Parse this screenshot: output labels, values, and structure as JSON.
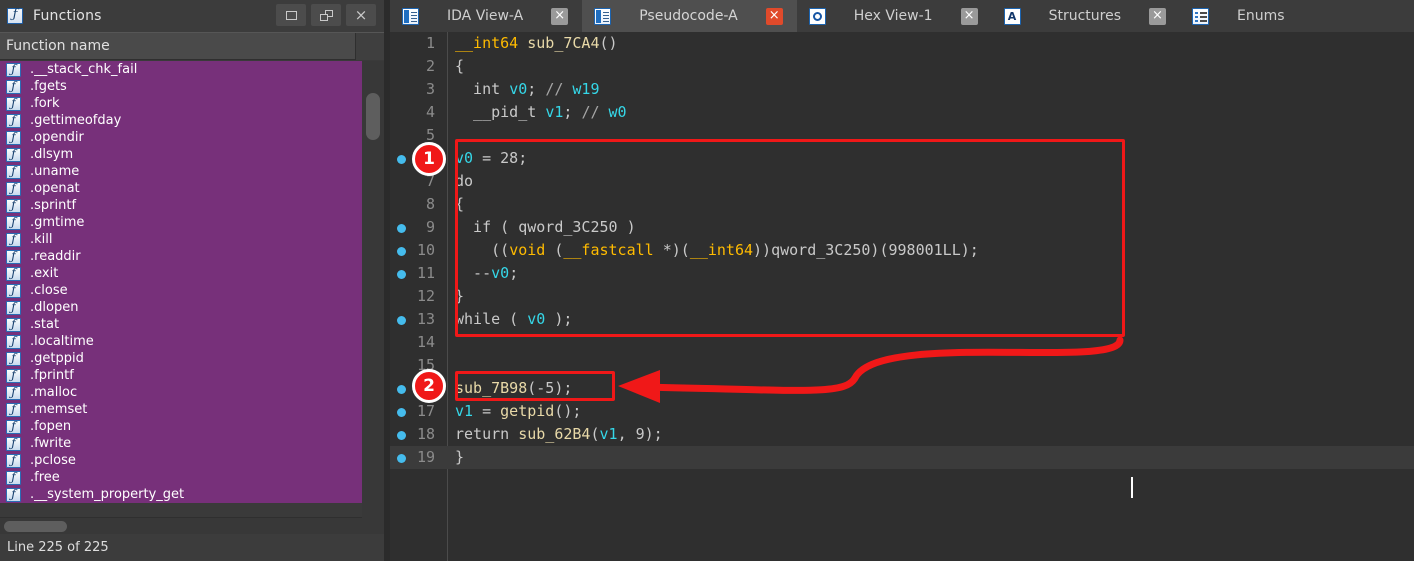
{
  "functions_panel": {
    "title": "Functions",
    "icon": "function-icon",
    "column_header": "Function name",
    "window_buttons": [
      {
        "name": "restore-button",
        "icon": "restore-icon"
      },
      {
        "name": "maximize-button",
        "icon": "maximize-icon"
      },
      {
        "name": "close-button",
        "icon": "close-icon"
      }
    ],
    "items": [
      ".__stack_chk_fail",
      ".fgets",
      ".fork",
      ".gettimeofday",
      ".opendir",
      ".dlsym",
      ".uname",
      ".openat",
      ".sprintf",
      ".gmtime",
      ".kill",
      ".readdir",
      ".exit",
      ".close",
      ".dlopen",
      ".stat",
      ".localtime",
      ".getppid",
      ".fprintf",
      ".malloc",
      ".memset",
      ".fopen",
      ".fwrite",
      ".pclose",
      ".free",
      ".__system_property_get"
    ],
    "status": "Line 225 of 225"
  },
  "tabs": [
    {
      "label": "IDA View-A",
      "icon": "document-icon",
      "active": false,
      "close_icon": "close-icon",
      "close_style": "gray"
    },
    {
      "label": "Pseudocode-A",
      "icon": "document-icon",
      "active": true,
      "close_icon": "close-icon",
      "close_style": "red"
    },
    {
      "label": "Hex View-1",
      "icon": "hex-view-icon",
      "active": false,
      "close_icon": "close-icon",
      "close_style": "gray"
    },
    {
      "label": "Structures",
      "icon": "structures-icon",
      "active": false,
      "close_icon": "close-icon",
      "close_style": "gray"
    },
    {
      "label": "Enums",
      "icon": "enums-icon",
      "active": false,
      "close_icon": "",
      "close_style": ""
    }
  ],
  "code": {
    "lines": [
      {
        "no": "1",
        "dot": false,
        "highlight": false
      },
      {
        "no": "2",
        "dot": false,
        "highlight": false
      },
      {
        "no": "3",
        "dot": false,
        "highlight": false
      },
      {
        "no": "4",
        "dot": false,
        "highlight": false
      },
      {
        "no": "5",
        "dot": false,
        "highlight": false
      },
      {
        "no": "6",
        "dot": true,
        "highlight": false
      },
      {
        "no": "7",
        "dot": false,
        "highlight": false
      },
      {
        "no": "8",
        "dot": false,
        "highlight": false
      },
      {
        "no": "9",
        "dot": true,
        "highlight": false
      },
      {
        "no": "10",
        "dot": true,
        "highlight": false
      },
      {
        "no": "11",
        "dot": true,
        "highlight": false
      },
      {
        "no": "12",
        "dot": false,
        "highlight": false
      },
      {
        "no": "13",
        "dot": true,
        "highlight": false
      },
      {
        "no": "14",
        "dot": false,
        "highlight": false
      },
      {
        "no": "15",
        "dot": false,
        "highlight": false
      },
      {
        "no": "16",
        "dot": true,
        "highlight": false
      },
      {
        "no": "17",
        "dot": true,
        "highlight": false
      },
      {
        "no": "18",
        "dot": true,
        "highlight": false
      },
      {
        "no": "19",
        "dot": true,
        "highlight": true
      }
    ],
    "text": {
      "l1_type": "__int64",
      "l1_name": " sub_7CA4",
      "l1_paren": "()",
      "l2": "{",
      "l3_type": "  int ",
      "l3_var": "v0",
      "l3_semi": "; ",
      "l3_cmt": "// ",
      "l3_reg": "w19",
      "l4_type": "  __pid_t ",
      "l4_var": "v1",
      "l4_semi": "; ",
      "l4_cmt": "// ",
      "l4_reg": "w0",
      "l5": "",
      "l6_var": "v0",
      "l6_rest": " = 28;",
      "l7": "do",
      "l8": "{",
      "l9": "  if ( qword_3C250 )",
      "l10_a": "    ((",
      "l10_void": "void",
      "l10_b": " (",
      "l10_fast": "__fastcall",
      "l10_c": " *)(",
      "l10_int": "__int64",
      "l10_d": "))qword_3C250)(998001LL);",
      "l11_a": "  --",
      "l11_var": "v0",
      "l11_b": ";",
      "l12": "}",
      "l13_a": "while ( ",
      "l13_var": "v0",
      "l13_b": " );",
      "l14": "",
      "l15": "",
      "l16_fn": "sub_7B98",
      "l16_rest": "(-5);",
      "l17_var": "v1",
      "l17_eq": " = ",
      "l17_fn": "getpid",
      "l17_rest": "();",
      "l18_ret": "return ",
      "l18_fn": "sub_62B4",
      "l18_a": "(",
      "l18_var": "v1",
      "l18_b": ", 9);",
      "l19": "}"
    }
  },
  "annotations": {
    "color": "#f01818",
    "badge1": "1",
    "badge2": "2"
  }
}
